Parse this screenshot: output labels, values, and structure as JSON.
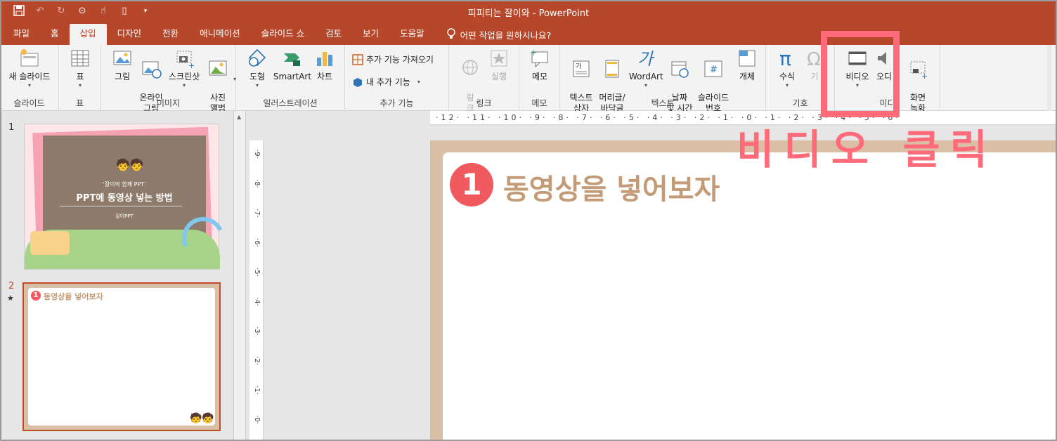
{
  "window": {
    "title": "피피티는 잘이와  -  PowerPoint"
  },
  "tabs": [
    "파일",
    "홈",
    "삽입",
    "디자인",
    "전환",
    "애니메이션",
    "슬라이드 쇼",
    "검토",
    "보기",
    "도움말"
  ],
  "active_tab": "삽입",
  "tell_me": "어떤 작업을 원하시나요?",
  "ribbon": {
    "slides": {
      "label": "슬라이드",
      "new_slide": "새 슬라이드"
    },
    "table": {
      "label": "표",
      "table": "표"
    },
    "images": {
      "label": "이미지",
      "picture": "그림",
      "online_picture": "온라인\n그림",
      "screenshot": "스크린샷",
      "album": "사진\n앨범"
    },
    "illustrations": {
      "label": "일러스트레이션",
      "shapes": "도형",
      "smartart": "SmartArt",
      "chart": "차트"
    },
    "addins": {
      "label": "추가 기능",
      "get": "추가 기능 가져오기",
      "my": "내 추가 기능"
    },
    "links": {
      "label": "링크",
      "link": "링\n크",
      "action": "실행"
    },
    "comments": {
      "label": "메모",
      "comment": "메모"
    },
    "text": {
      "label": "텍스트",
      "textbox": "텍스트\n상자",
      "header_footer": "머리글/\n바닥글",
      "wordart": "WordArt",
      "datetime": "날짜\n및 시간",
      "slide_number": "슬라이드\n번호",
      "object": "개체"
    },
    "symbols": {
      "label": "기호",
      "equation": "수식",
      "symbol": "기"
    },
    "media": {
      "label": "미디",
      "video": "비디오",
      "audio": "오디",
      "screen_rec": "화면\n녹화"
    }
  },
  "ruler": {
    "h": "·12· ·11· ·10· ·9· ·8· ·7· ·6· ·5· ·4· ·3· ·2· ·1· ·0· ·1· ·2· ·3· ·4· ·5· ·6·"
  },
  "slides": [
    {
      "number": "1",
      "subtitle": "'잘이와 함께 PPT'",
      "title": "PPT에 동영상 넣는 방법",
      "author": "잘이PPT"
    },
    {
      "number": "2",
      "star": "★",
      "title": "동영상을 넣어보자",
      "badge": "1"
    }
  ],
  "main_slide": {
    "badge": "1",
    "title": "동영상을 넣어보자"
  },
  "annotation": {
    "text": "비디오 클릭"
  },
  "colors": {
    "accent": "#b7472a",
    "brown": "#c39b77",
    "badge": "#f05a5f",
    "highlight": "#ff6b7a"
  }
}
